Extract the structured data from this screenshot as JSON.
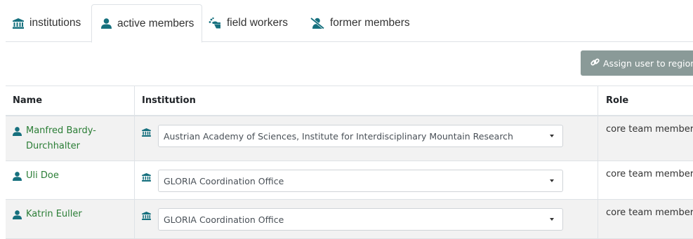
{
  "tabs": [
    {
      "label": "institutions",
      "icon": "institution-icon"
    },
    {
      "label": "active members",
      "icon": "user-icon"
    },
    {
      "label": "field workers",
      "icon": "field-worker-icon"
    },
    {
      "label": "former members",
      "icon": "user-slash-icon"
    }
  ],
  "toolbar": {
    "assign_label": "Assign user to region",
    "assign_icon": "link-icon"
  },
  "table": {
    "headers": {
      "name": "Name",
      "institution": "Institution",
      "role": "Role"
    },
    "rows": [
      {
        "name_line1": "Manfred Bardy-",
        "name_line2": "Durchhalter",
        "institution": "Austrian Academy of Sciences, Institute for Interdisciplinary Mountain Research",
        "role": "core team member"
      },
      {
        "name_line1": "Uli Doe",
        "name_line2": "",
        "institution": "GLORIA Coordination Office",
        "role": "core team member"
      },
      {
        "name_line1": "Katrin Euller",
        "name_line2": "",
        "institution": "GLORIA Coordination Office",
        "role": "core team member"
      }
    ]
  },
  "colors": {
    "accent": "#16707e",
    "link_green": "#2a7d35",
    "button_gray": "#8a9a98"
  }
}
